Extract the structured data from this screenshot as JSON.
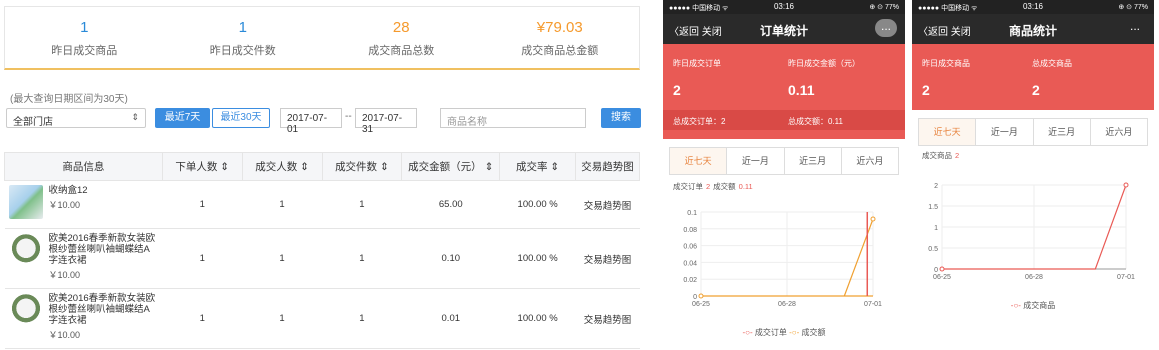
{
  "stats": [
    {
      "value": "1",
      "label": "昨日成交商品"
    },
    {
      "value": "1",
      "label": "昨日成交件数"
    },
    {
      "value": "28",
      "label": "成交商品总数"
    },
    {
      "value": "¥79.03",
      "label": "成交商品总金额"
    }
  ],
  "hint": "(最大查询日期区间为30天)",
  "filters": {
    "store": "全部门店",
    "btn7": "最近7天",
    "btn30": "最近30天",
    "date_from": "2017-07-01",
    "date_sep": "--",
    "date_to": "2017-07-31",
    "product_placeholder": "商品名称",
    "search": "搜索"
  },
  "table": {
    "headers": [
      "商品信息",
      "下单人数 ⇕",
      "成交人数 ⇕",
      "成交件数 ⇕",
      "成交金额（元） ⇕",
      "成交率 ⇕",
      "交易趋势图"
    ],
    "rows": [
      {
        "name": "收纳盒12",
        "price": "￥10.00",
        "orders": "1",
        "buyers": "1",
        "pieces": "1",
        "amount": "65.00",
        "rate": "100.00 %",
        "trend": "交易趋势图"
      },
      {
        "name": "欧美2016春季新款女装欧根纱蕾丝喇叭袖蝴蝶结A字连衣裙",
        "price": "￥10.00",
        "orders": "1",
        "buyers": "1",
        "pieces": "1",
        "amount": "0.10",
        "rate": "100.00 %",
        "trend": "交易趋势图"
      },
      {
        "name": "欧美2016春季新款女装欧根纱蕾丝喇叭袖蝴蝶结A字连衣裙",
        "price": "￥10.00",
        "orders": "1",
        "buyers": "1",
        "pieces": "1",
        "amount": "0.01",
        "rate": "100.00 %",
        "trend": "交易趋势图"
      }
    ]
  },
  "phone1": {
    "status": {
      "carrier": "●●●●● 中国移动 ᯤ",
      "time": "03:16",
      "right": "⊕ ⊙ 77%"
    },
    "nav": {
      "back": "〈返回  关闭",
      "title": "订单统计",
      "more": "..."
    },
    "labels": {
      "a": "昨日成交订单",
      "b": "昨日成交金额（元）",
      "va": "2",
      "vb": "0.11",
      "c": "总成交订单：2",
      "d": "总成交额：0.11"
    },
    "tabs": [
      "近七天",
      "近一月",
      "近三月",
      "近六月"
    ],
    "summary": {
      "a": "成交订单",
      "av": "2",
      "b": "成交额",
      "bv": "0.11"
    },
    "legend": {
      "a": "成交订单",
      "b": "成交额"
    }
  },
  "phone2": {
    "status": {
      "carrier": "●●●●● 中国移动 ᯤ",
      "time": "03:16",
      "right": "⊕ ⊙ 77%"
    },
    "nav": {
      "back": "〈返回  关闭",
      "title": "商品统计",
      "more": "..."
    },
    "labels": {
      "a": "昨日成交商品",
      "b": "总成交商品",
      "va": "2",
      "vb": "2"
    },
    "tabs": [
      "近七天",
      "近一月",
      "近三月",
      "近六月"
    ],
    "summary": {
      "a": "成交商品",
      "av": "2"
    },
    "legend": {
      "a": "成交商品"
    }
  },
  "chart_data": [
    {
      "type": "line",
      "x": [
        "06-25",
        "06-28",
        "07-01"
      ],
      "yticks": [
        "0",
        "0.02",
        "0.04",
        "0.06",
        "0.08",
        "0.1"
      ],
      "ylim": [
        0,
        0.12
      ],
      "series": [
        {
          "name": "成交订单",
          "color": "#e95a55"
        },
        {
          "name": "成交额",
          "color": "#f0a030"
        }
      ]
    },
    {
      "type": "line",
      "x": [
        "06-25",
        "06-28",
        "07-01"
      ],
      "yticks": [
        "0",
        "0.5",
        "1",
        "1.5",
        "2"
      ],
      "ylim": [
        0,
        2
      ],
      "series": [
        {
          "name": "成交商品",
          "color": "#e95a55",
          "values": [
            0,
            0,
            0,
            0,
            0,
            0,
            2
          ]
        }
      ]
    }
  ],
  "colors": {
    "accent": "#3b8de0",
    "orange": "#f59a2d",
    "red": "#e95a55"
  }
}
